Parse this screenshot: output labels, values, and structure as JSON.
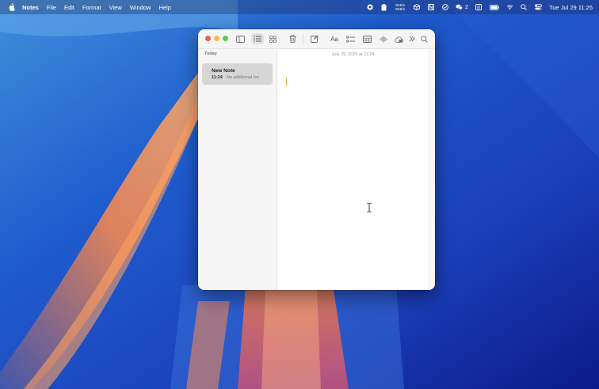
{
  "colors": {
    "accent_caret": "#e0b54a",
    "traffic_close": "#ec5f57",
    "traffic_minimize": "#f4bd4f",
    "traffic_zoom": "#61c454",
    "selected_note_bg": "#d6d6d6"
  },
  "menubar": {
    "app_name": "Notes",
    "menus": [
      "File",
      "Edit",
      "Format",
      "View",
      "Window",
      "Help"
    ],
    "net_up": "0KB/s",
    "net_down": "0KB/s",
    "wechat_count": "2",
    "clock": "Tue Jul 29  11:25",
    "status_icons": [
      "record-icon",
      "clipboard-icon",
      "network-stats-icon",
      "cube-icon",
      "notion-icon",
      "checkmark-icon",
      "wechat-icon",
      "archive-icon",
      "battery-icon",
      "wifi-icon",
      "search-icon",
      "control-center-icon"
    ]
  },
  "toolbar": {
    "icons": [
      "sidebar-toggle-icon",
      "list-view-icon",
      "gallery-view-icon",
      "trash-icon",
      "compose-icon",
      "format-text-icon",
      "checklist-icon",
      "table-icon",
      "audio-icon",
      "lock-icon",
      "more-icon",
      "search-icon"
    ],
    "format_label": "Aa"
  },
  "sidebar": {
    "section": "Today",
    "notes": [
      {
        "title": "New Note",
        "time": "11:24",
        "preview": "No additional tex"
      }
    ]
  },
  "editor": {
    "date": "July 29, 2025 at 11:24",
    "body": ""
  }
}
